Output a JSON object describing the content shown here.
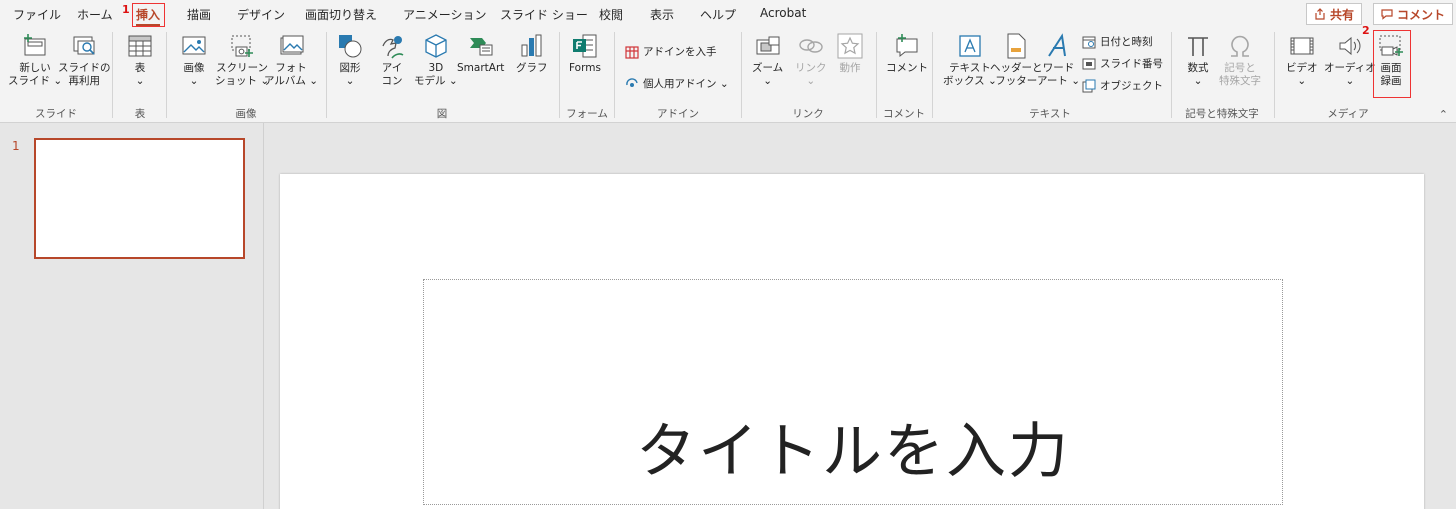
{
  "tabs": [
    {
      "label": "ファイル"
    },
    {
      "label": "ホーム"
    },
    {
      "label": "挿入"
    },
    {
      "label": "描画"
    },
    {
      "label": "デザイン"
    },
    {
      "label": "画面切り替え"
    },
    {
      "label": "アニメーション"
    },
    {
      "label": "スライド ショー"
    },
    {
      "label": "校閲"
    },
    {
      "label": "表示"
    },
    {
      "label": "ヘルプ"
    },
    {
      "label": "Acrobat"
    }
  ],
  "steps": {
    "one": "1",
    "two": "2"
  },
  "header": {
    "share_label": "共有",
    "comment_label": "コメント"
  },
  "ribbon": {
    "groups": {
      "slides": "スライド",
      "table": "表",
      "images": "画像",
      "illustrations": "図",
      "forms": "フォーム",
      "addins": "アドイン",
      "links": "リンク",
      "comments": "コメント",
      "text": "テキスト",
      "symbols": "記号と特殊文字",
      "media": "メディア"
    },
    "buttons": {
      "new_slide": "新しい\nスライド ⌄",
      "reuse_slides": "スライドの\n再利用",
      "table": "表\n⌄",
      "pictures": "画像\n⌄",
      "screenshot": "スクリーン\nショット ⌄",
      "photo_album": "フォト\nアルバム ⌄",
      "shapes": "図形\n⌄",
      "icons": "アイ\nコン",
      "models_3d": "3D\nモデル ⌄",
      "smartart": "SmartArt",
      "chart": "グラフ",
      "forms": "Forms",
      "get_addins": "アドインを入手",
      "my_addins": "個人用アドイン ⌄",
      "zoom": "ズーム\n⌄",
      "link": "リンク\n⌄",
      "action": "動作",
      "comment": "コメント",
      "textbox": "テキスト\nボックス ⌄",
      "header_footer": "ヘッダーと\nフッター",
      "wordart": "ワード\nアート ⌄",
      "date_time": "日付と時刻",
      "slide_number": "スライド番号",
      "object": "オブジェクト",
      "equation": "数式\n⌄",
      "symbol": "記号と\n特殊文字",
      "video": "ビデオ\n⌄",
      "audio": "オーディオ\n⌄",
      "screen_recording": "画面\n録画"
    }
  },
  "thumbnails": [
    {
      "number": "1"
    }
  ],
  "slide": {
    "title_placeholder": "タイトルを入力"
  },
  "colors": {
    "accent": "#b7472a",
    "highlight": "#e33333"
  }
}
